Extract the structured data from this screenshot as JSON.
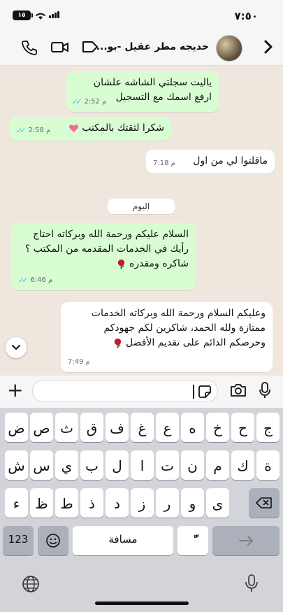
{
  "status_bar": {
    "time": "٧:٥٠",
    "battery": "١٥"
  },
  "header": {
    "contact_name": "خديجه مطر عقيل -بو...",
    "back_icon": "chevron-right-icon",
    "icons": [
      "phone-icon",
      "video-camera-icon",
      "tag-icon"
    ]
  },
  "messages": [
    {
      "type": "out",
      "text": "ياليت سجلتي الشاشه علشان ارفع اسمك مع التسجيل",
      "time": "2:52 م"
    },
    {
      "type": "out",
      "text": "شكرا لثقتك بالمكتب",
      "emoji": "sparkling-heart",
      "time": "2:58 م"
    },
    {
      "type": "out",
      "text": "ماقلتوا لي من اول",
      "time": "7:18 م"
    },
    {
      "type": "out",
      "text": "السلام عليكم ورحمة الله وبركاته احتاج رأيك في الخدمات المقدمه من المكتب ؟ شاكره ومقدره",
      "emoji": "rose",
      "time": "6:46 م"
    },
    {
      "type": "in",
      "text": "وعليكم السلام ورحمة الله وبركاته الخدمات ممتازة ولله الحمد، شاكرين لكم جهودكم وحرصكم الدائم على تقديم الأفضل",
      "emoji": "rose",
      "time": "7:49 م"
    }
  ],
  "date_chip": "اليوم",
  "keyboard": {
    "row1": [
      "ج",
      "ح",
      "خ",
      "ه",
      "ع",
      "غ",
      "ف",
      "ق",
      "ث",
      "ص",
      "ض"
    ],
    "row2": [
      "ة",
      "ك",
      "م",
      "ن",
      "ت",
      "ا",
      "ل",
      "ب",
      "ي",
      "س",
      "ش"
    ],
    "row3": [
      "ى",
      "و",
      "ر",
      "ز",
      "د",
      "ذ",
      "ط",
      "ظ",
      "ء"
    ],
    "numbers_label": "123",
    "space_label": "مسافة",
    "diacritic_label": "ًّ"
  }
}
